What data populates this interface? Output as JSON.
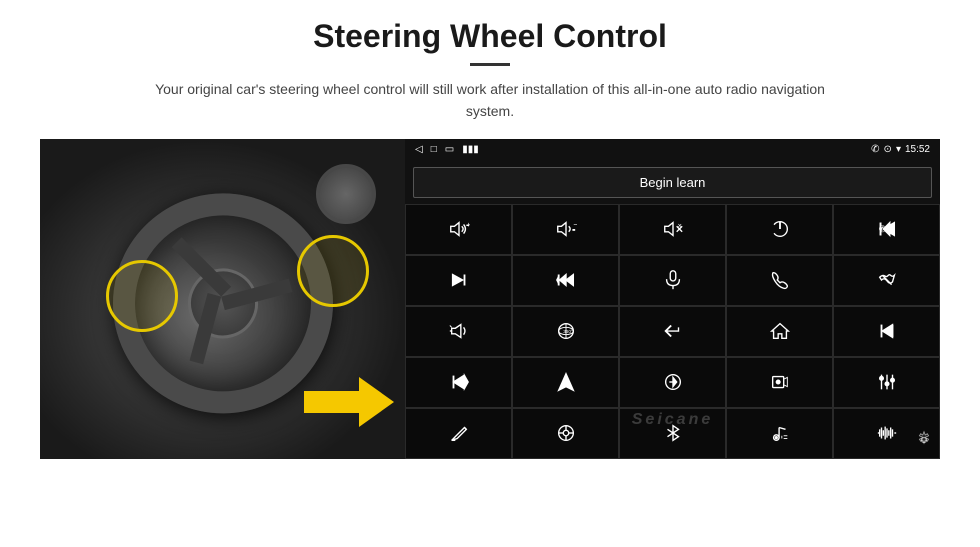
{
  "page": {
    "title": "Steering Wheel Control",
    "subtitle": "Your original car's steering wheel control will still work after installation of this all-in-one auto radio navigation system."
  },
  "status_bar": {
    "time": "15:52",
    "back_icon": "◁",
    "home_icon": "□",
    "recent_icon": "▭",
    "signal_icon": "▮▮▮",
    "phone_icon": "✆",
    "location_icon": "⊙",
    "wifi_icon": "▾"
  },
  "begin_learn": {
    "label": "Begin learn"
  },
  "watermark": {
    "text": "Seicane"
  },
  "controls": [
    {
      "id": "vol-up",
      "icon": "vol-up"
    },
    {
      "id": "vol-down",
      "icon": "vol-down"
    },
    {
      "id": "mute",
      "icon": "mute"
    },
    {
      "id": "power",
      "icon": "power"
    },
    {
      "id": "prev-track",
      "icon": "prev-track"
    },
    {
      "id": "next",
      "icon": "next"
    },
    {
      "id": "ff-prev",
      "icon": "ff-prev"
    },
    {
      "id": "mic",
      "icon": "mic"
    },
    {
      "id": "phone",
      "icon": "phone"
    },
    {
      "id": "hang-up",
      "icon": "hang-up"
    },
    {
      "id": "horn",
      "icon": "horn"
    },
    {
      "id": "360-view",
      "icon": "360-view"
    },
    {
      "id": "back",
      "icon": "back"
    },
    {
      "id": "home",
      "icon": "home"
    },
    {
      "id": "skip-start",
      "icon": "skip-start"
    },
    {
      "id": "skip-fwd",
      "icon": "skip-fwd"
    },
    {
      "id": "nav",
      "icon": "nav"
    },
    {
      "id": "swap",
      "icon": "swap"
    },
    {
      "id": "record",
      "icon": "record"
    },
    {
      "id": "eq",
      "icon": "eq"
    },
    {
      "id": "pen",
      "icon": "pen"
    },
    {
      "id": "settings2",
      "icon": "settings2"
    },
    {
      "id": "bt",
      "icon": "bt"
    },
    {
      "id": "music-settings",
      "icon": "music-settings"
    },
    {
      "id": "waveform",
      "icon": "waveform"
    }
  ]
}
